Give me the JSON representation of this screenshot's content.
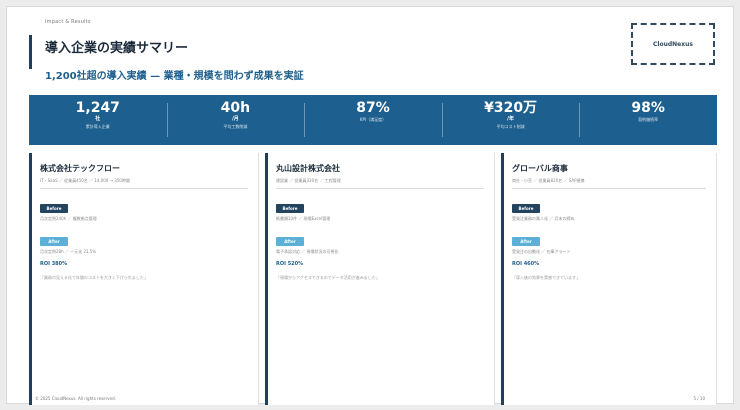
{
  "slide": {
    "eyebrow": "Impact & Results",
    "title": "導入企業の実績サマリー",
    "subtitle": "1,200社超の導入実績 — 業種・規模を問わず成果を実証",
    "logo": "CloudNexus"
  },
  "stats": [
    {
      "value": "1,247",
      "unit": "社",
      "label": "累計導入企業"
    },
    {
      "value": "40h",
      "unit": "/月",
      "label": "平均工数削減"
    },
    {
      "value": "87%",
      "unit": "",
      "label": "KPI（満足度）"
    },
    {
      "value": "¥320万",
      "unit": "/年",
      "label": "平均コスト削減"
    },
    {
      "value": "98%",
      "unit": "",
      "label": "契約継続率"
    }
  ],
  "cards": [
    {
      "name": "株式会社テックフロー",
      "meta": "IT・SaaS ／ 従業員450名 ／ 14,000 → 350時間",
      "before_label": "Before",
      "before_text": "月次定例240h ／ 複数拠点管理",
      "after_label": "After",
      "after_text": "月次定例28h ／ 一元化 21.5%",
      "roi": "ROI 380%",
      "quote": "「業務の見える化で年間のコストを大きく下げられました」"
    },
    {
      "name": "丸山設計株式会社",
      "meta": "建設業 ／ 従業員320名 ／ 工程管理",
      "before_label": "Before",
      "before_text": "紙書類10件 ／ 現場Excel管理",
      "after_label": "After",
      "after_text": "電子承認対応 ／ 現場状況の可視化",
      "roi": "ROI 520%",
      "quote": "「現場からアクセスできるのでデータ活用が進みました」"
    },
    {
      "name": "グローバル商事",
      "meta": "商社・小売 ／ 従業員820名 ／ SAP連携",
      "before_label": "Before",
      "before_text": "受発注業務の属人化 ／ 月末の締め",
      "after_label": "After",
      "after_text": "受発注の自動化 ／ 在庫アラート",
      "roi": "ROI 460%",
      "quote": "「導入後の効果を実感できています」"
    }
  ],
  "footer": {
    "copyright": "© 2025 CloudNexus. All rights reserved.",
    "page": "5 / 10"
  }
}
